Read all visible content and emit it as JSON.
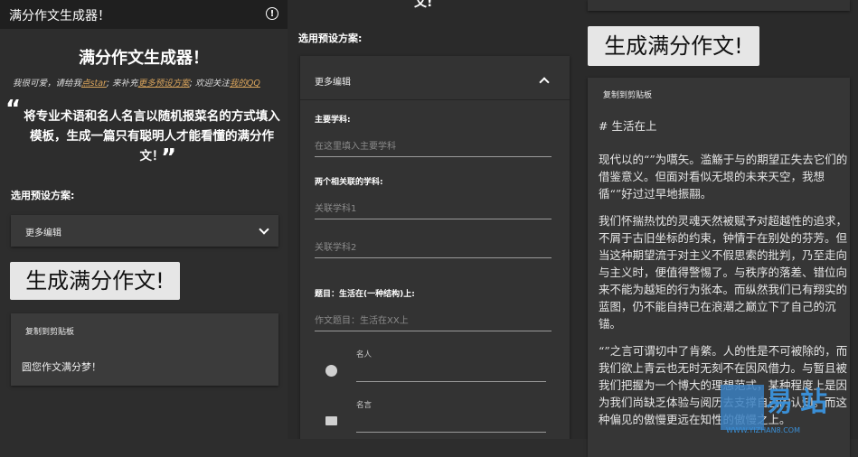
{
  "app": {
    "title": "满分作文生成器！",
    "info_icon": "info-icon"
  },
  "panel1": {
    "heading": "满分作文生成器！",
    "note_prefix": "我很可爱，请给我",
    "note_link_star": "点star",
    "note_mid": "; 来补充",
    "note_link_preset": "更多预设方案",
    "note_mid2": "; 欢迎关注",
    "note_link_qq": "我的QQ",
    "quote_open": "“",
    "quote_text": "将专业术语和名人名言以随机报菜名的方式填入模板，生成一篇只有聪明人才能看懂的满分作文！",
    "quote_close": "”",
    "preset_label": "选用预设方案:",
    "preset_value": "更多编辑",
    "generate_button": "生成满分作文!",
    "copy_label": "复制到剪贴板",
    "output_text": "圆您作文满分梦！"
  },
  "panel2": {
    "top_partial": "文!",
    "preset_label": "选用预设方案:",
    "expand_title": "更多编辑",
    "main_subject_label": "主要学科:",
    "main_subject_placeholder": "在这里填入主要学科",
    "related_label": "两个相关联的学科:",
    "related1_placeholder": "关联学科1",
    "related2_placeholder": "关联学科2",
    "topic_label": "题目：生活在(一种结构)上:",
    "topic_placeholder": "作文题目：生活在XX上",
    "person_label": "名人",
    "quote_label": "名言"
  },
  "panel3": {
    "generate_button": "生成满分作文!",
    "copy_label": "复制到剪贴板",
    "essay_heading": "# 生活在上",
    "paragraphs": [
      "现代以的“”为嚆矢。滥觞于与的期望正失去它们的借鉴意义。但面对看似无垠的未来天空，我想循“”好过过早地振翮。",
      "我们怀揣热忱的灵魂天然被赋予对超越性的追求，不屑于古旧坐标的约束，钟情于在别处的芬芳。但当这种期望流于对主义不假思索的批判，乃至走向与主义时，便值得警惕了。与秩序的落差、错位向来不能为越矩的行为张本。而纵然我们已有翔实的蓝图，仍不能自持已在浪潮之巅立下了自己的沉锚。",
      "“”之言可谓切中了肯綮。人的性是不可被除的，而我们欲上青云也无时无刻不在因风借力。与暂且被我们把握为一个博大的理想范式，某种程度上是因为我们尚缺乏体验与阅历去支撑自己的认知。而这种偏见的傲慢更远在知性的傲慢之上。"
    ]
  },
  "watermark": {
    "text": "易站",
    "sub": "WWW.YIZHAN8.COM"
  },
  "colors": {
    "background": "#2d2d2d",
    "appbar": "#1f1f1f",
    "card": "#393939",
    "link": "#d9a45c",
    "button": "#e6e6e6",
    "watermark": "#3a8fd6"
  }
}
